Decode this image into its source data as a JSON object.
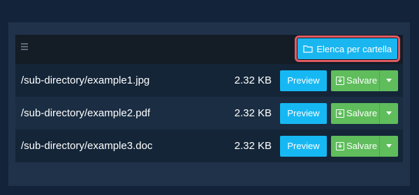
{
  "toolbar": {
    "list_by_folder_label": "Elenca per cartella"
  },
  "files": [
    {
      "name": "/sub-directory/example1.jpg",
      "size": "2.32 KB",
      "preview_label": "Preview",
      "save_label": "Salvare"
    },
    {
      "name": "/sub-directory/example2.pdf",
      "size": "2.32 KB",
      "preview_label": "Preview",
      "save_label": "Salvare"
    },
    {
      "name": "/sub-directory/example3.doc",
      "size": "2.32 KB",
      "preview_label": "Preview",
      "save_label": "Salvare"
    }
  ],
  "colors": {
    "accent": "#1ab6f0",
    "save": "#5fbd5c",
    "highlight": "#e35b64"
  },
  "icons": {
    "menu": "hamburger-icon",
    "folder": "folder-icon",
    "download": "download-icon",
    "caret": "caret-down-icon"
  }
}
